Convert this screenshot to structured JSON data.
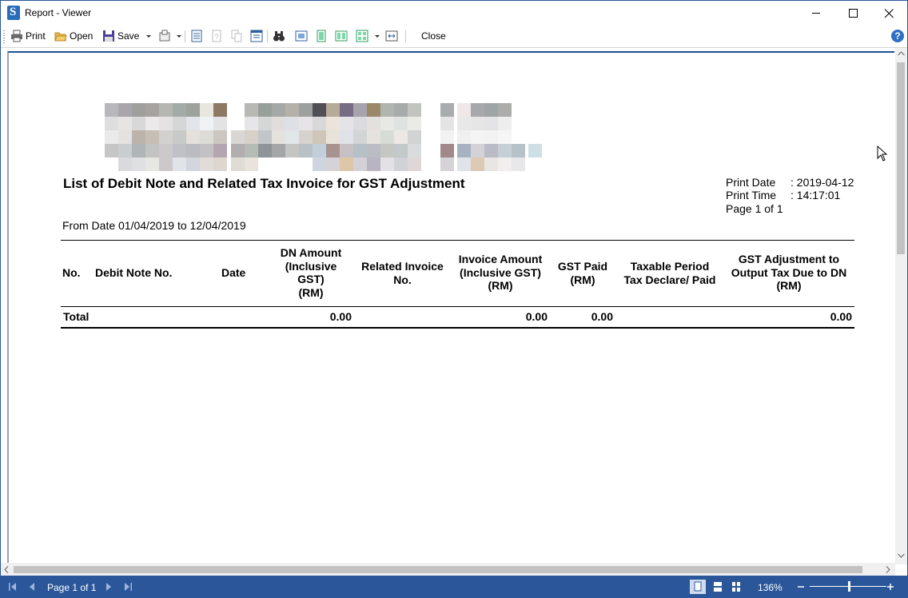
{
  "window": {
    "title": "Report - Viewer",
    "buttons": [
      "minimize-icon",
      "maximize-icon",
      "close-icon"
    ]
  },
  "toolbar": {
    "print_label": "Print",
    "open_label": "Open",
    "save_label": "Save",
    "close_label": "Close",
    "help_label": "?"
  },
  "report": {
    "title": "List of Debit Note and Related Tax Invoice for GST Adjustment",
    "from_text": "From Date 01/04/2019 to 12/04/2019",
    "print_date_label": "Print Date",
    "print_date_value": ": 2019-04-12",
    "print_time_label": "Print Time",
    "print_time_value": ": 14:17:01",
    "page_text": "Page 1 of 1",
    "columns": [
      "No.",
      "Debit Note No.",
      "Date",
      "DN Amount\n(Inclusive\nGST)\n(RM)",
      "Related Invoice\nNo.",
      "Invoice Amount\n(Inclusive GST)\n(RM)",
      "GST Paid\n(RM)",
      "Taxable Period\nTax Declare/ Paid",
      "GST Adjustment to\nOutput Tax Due to DN\n(RM)"
    ],
    "total_row": {
      "label": "Total",
      "dn_amount": "0.00",
      "invoice_amount": "0.00",
      "gst_paid": "0.00",
      "gst_adjustment": "0.00"
    }
  },
  "status": {
    "page_label": "Page 1 of 1",
    "zoom": "136%"
  },
  "colors": {
    "status_bar": "#2b579a",
    "page_border_top": "#1f4f96"
  }
}
